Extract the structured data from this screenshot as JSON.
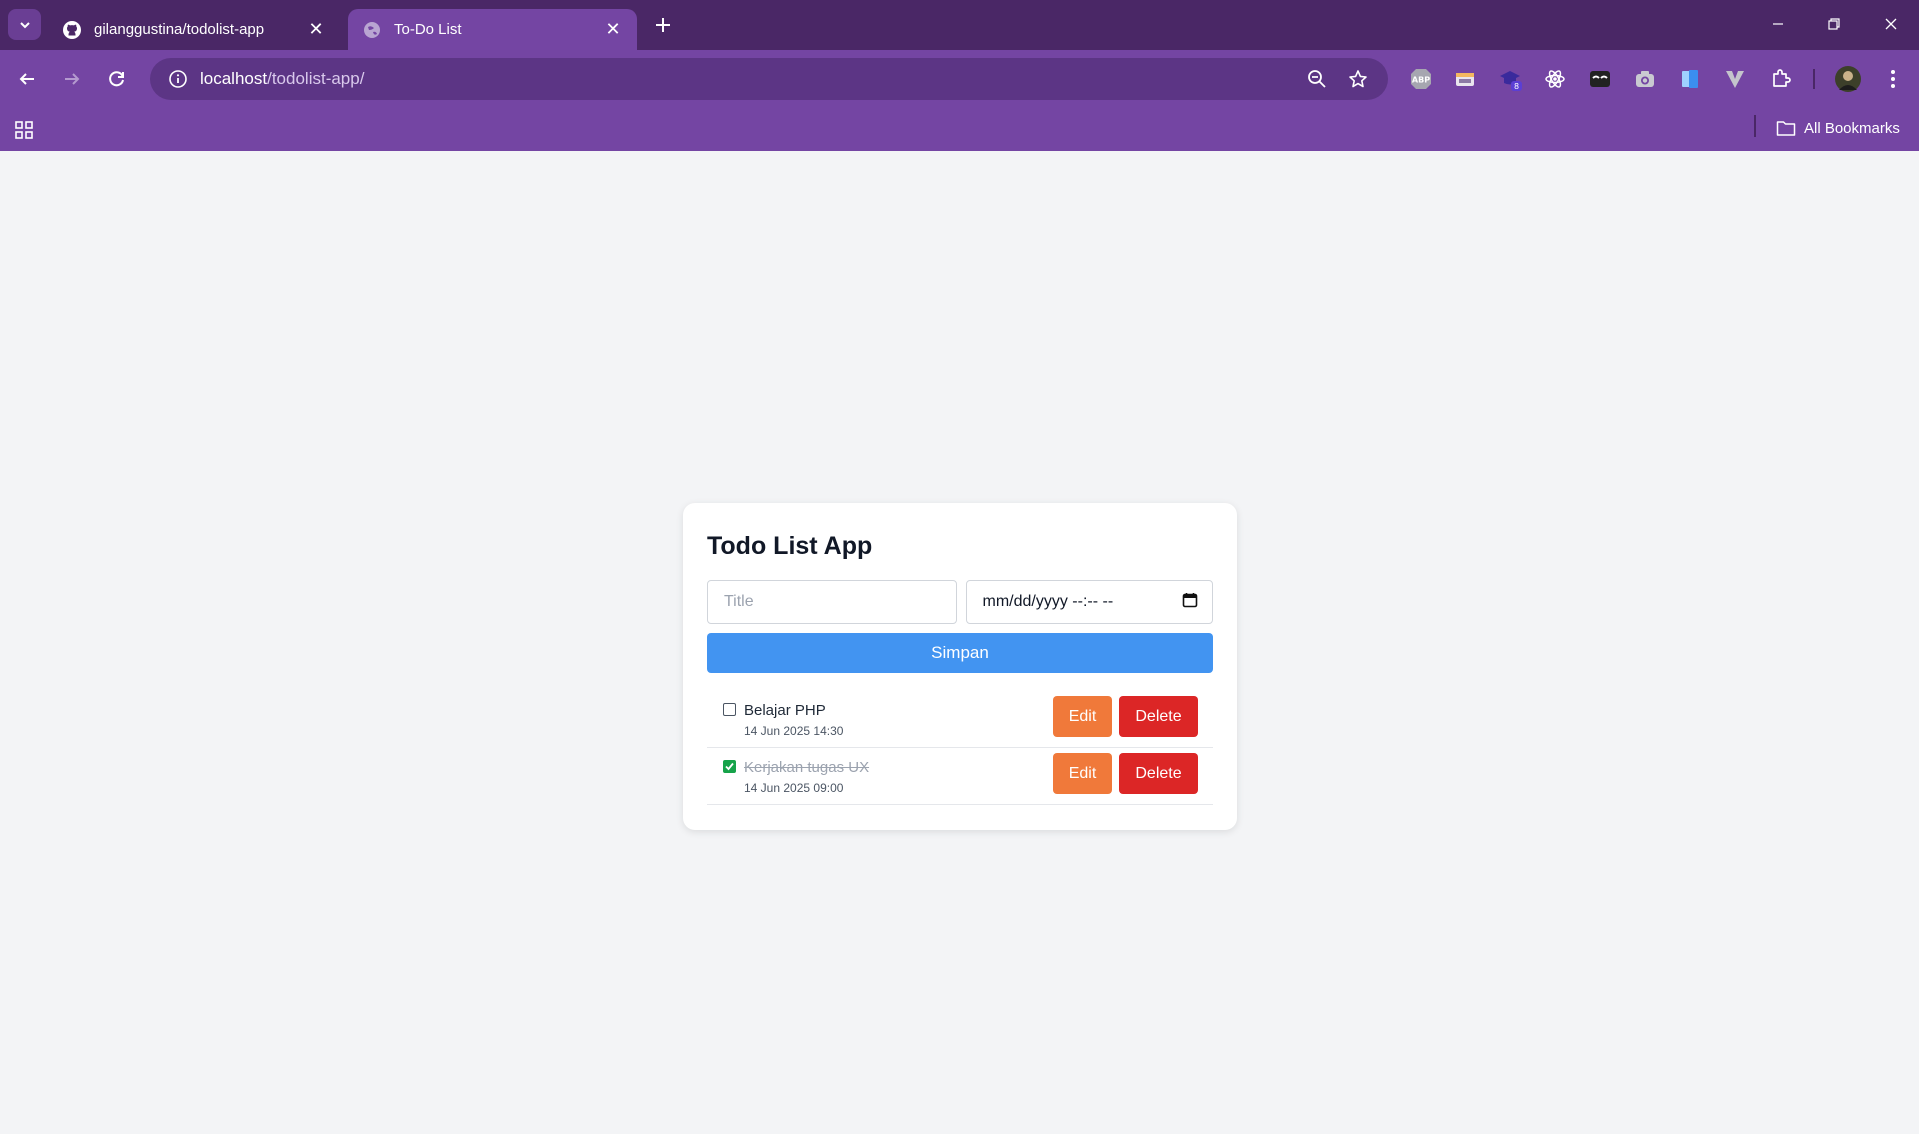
{
  "browser": {
    "tabs": [
      {
        "title": "gilanggustina/todolist-app",
        "icon": "github-icon"
      },
      {
        "title": "To-Do List",
        "icon": "globe-icon"
      }
    ],
    "url_host": "localhost",
    "url_path": "/todolist-app/",
    "extensions": [
      {
        "icon": "abp-icon",
        "label": "ABP"
      },
      {
        "icon": "window-icon"
      },
      {
        "icon": "cap-icon",
        "badge": "8"
      },
      {
        "icon": "atom-icon"
      },
      {
        "icon": "mask-icon"
      },
      {
        "icon": "camera-icon"
      },
      {
        "icon": "book-icon"
      },
      {
        "icon": "v-icon"
      },
      {
        "icon": "puzzle-icon"
      }
    ],
    "bookmarks_label": "All Bookmarks",
    "colors": {
      "titlebar": "#4a2766",
      "toolbar": "#7445a3"
    }
  },
  "app": {
    "title": "Todo List App",
    "title_placeholder": "Title",
    "date_placeholder": "mm/dd/yyyy --:-- --",
    "save_label": "Simpan",
    "todos": [
      {
        "title": "Belajar PHP",
        "date": "14 Jun 2025 14:30",
        "done": false
      },
      {
        "title": "Kerjakan tugas UX",
        "date": "14 Jun 2025 09:00",
        "done": true
      }
    ],
    "edit_label": "Edit",
    "delete_label": "Delete",
    "colors": {
      "save": "#4294f1",
      "edit": "#f0793a",
      "delete": "#dc2626"
    }
  }
}
